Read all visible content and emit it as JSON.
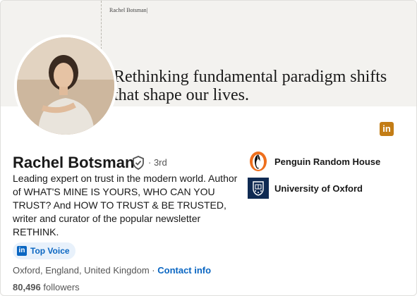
{
  "banner": {
    "small_text": "Rachel Botsman|",
    "tagline": "Rethinking fundamental paradigm shifts that shape our lives."
  },
  "profile": {
    "name": "Rachel Botsman",
    "degree": "· 3rd",
    "headline": "Leading expert on trust in the modern world. Author of WHAT'S MINE IS YOURS, WHO CAN YOU TRUST? And HOW TO TRUST & BE TRUSTED, writer and curator of the popular newsletter RETHINK.",
    "top_voice_label": "Top Voice",
    "location": "Oxford, England, United Kingdom",
    "separator": " · ",
    "contact_label": "Contact info",
    "followers_count": "80,496",
    "followers_label": " followers"
  },
  "organizations": [
    {
      "label": "Penguin Random House",
      "icon": "penguin-logo-icon"
    },
    {
      "label": "University of Oxford",
      "icon": "oxford-crest-icon"
    }
  ],
  "colors": {
    "accent": "#0a66c2",
    "linkedin_badge": "#c37d16"
  }
}
